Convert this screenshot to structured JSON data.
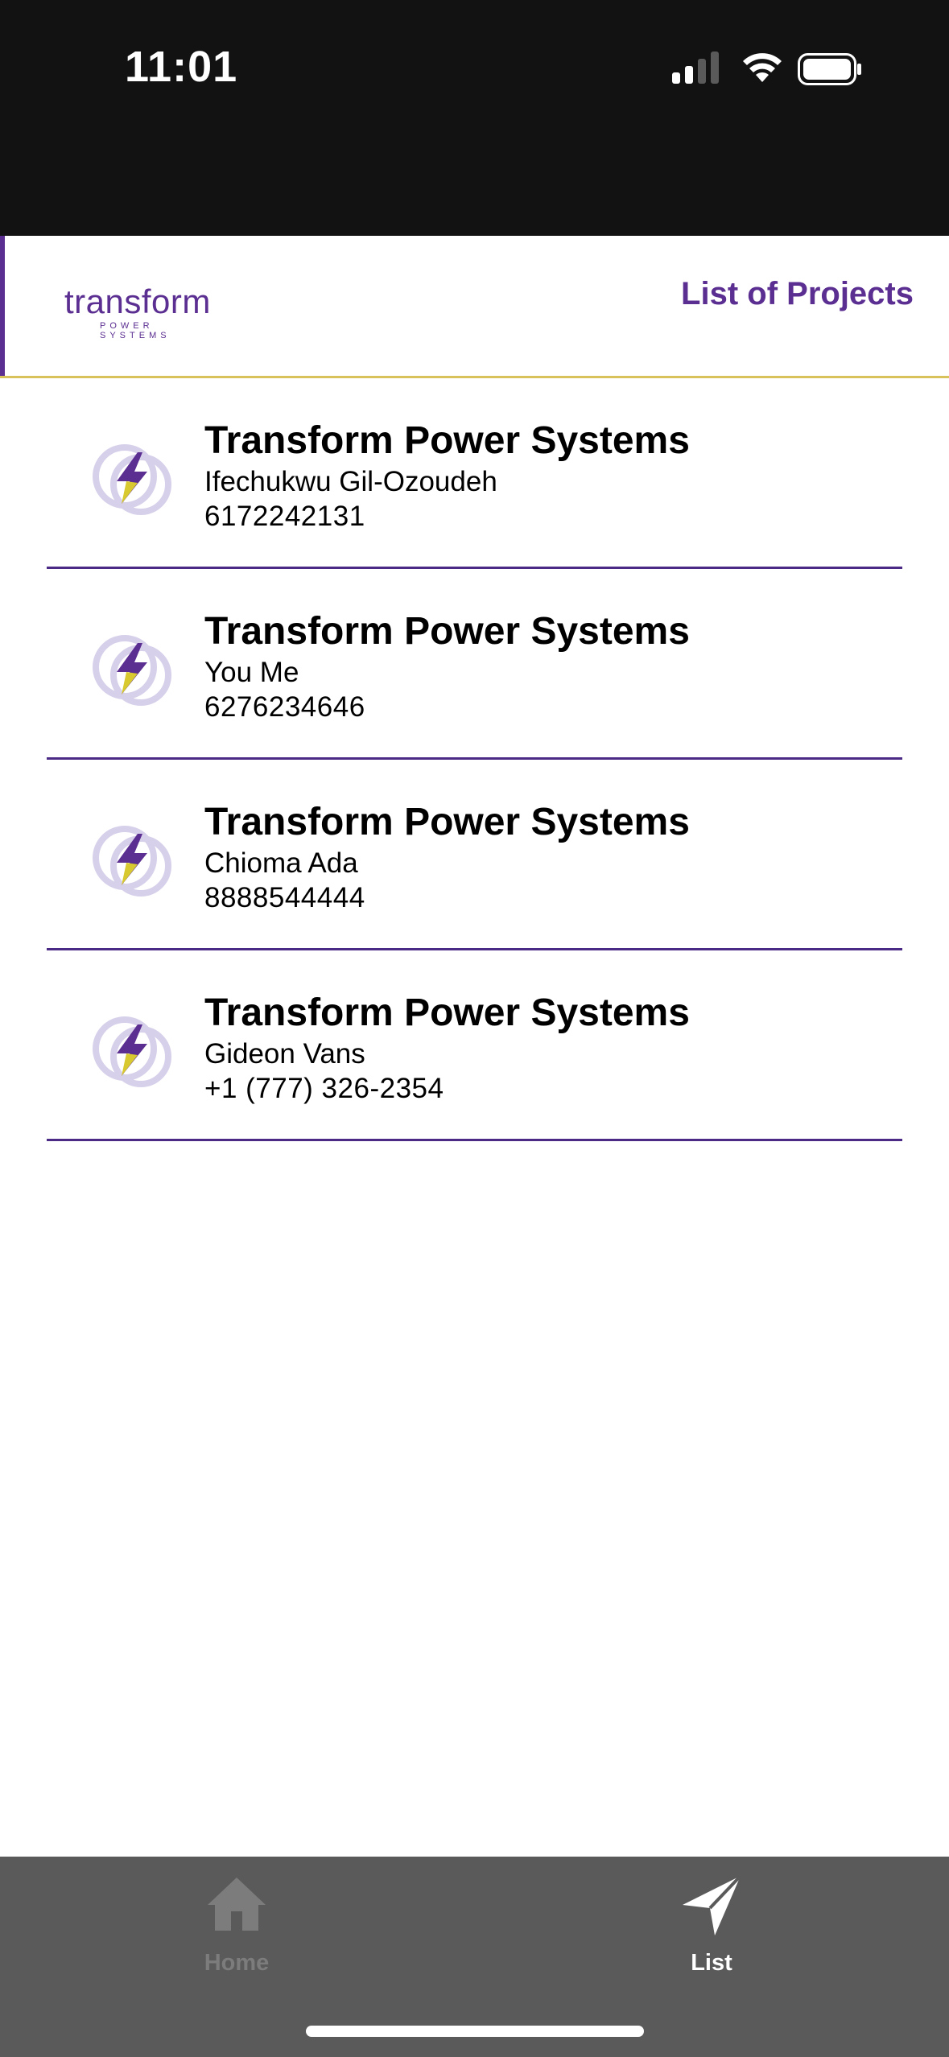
{
  "status_bar": {
    "time": "11:01",
    "icons": [
      "cellular-signal-icon",
      "wifi-icon",
      "battery-icon"
    ]
  },
  "header": {
    "logo_text": "transform",
    "logo_subtext": "POWER SYSTEMS",
    "title": "List of Projects"
  },
  "projects": [
    {
      "company": "Transform Power Systems",
      "contact": "Ifechukwu Gil-Ozoudeh",
      "phone": "6172242131"
    },
    {
      "company": "Transform Power Systems",
      "contact": "You Me",
      "phone": "6276234646"
    },
    {
      "company": "Transform Power Systems",
      "contact": "Chioma Ada",
      "phone": "8888544444"
    },
    {
      "company": "Transform Power Systems",
      "contact": "Gideon Vans",
      "phone": "+1 (777) 326-2354"
    }
  ],
  "tabs": [
    {
      "label": "Home",
      "icon": "home-icon",
      "active": false
    },
    {
      "label": "List",
      "icon": "send-icon",
      "active": true
    }
  ],
  "colors": {
    "brand_purple": "#5b2e91",
    "accent_yellow": "#d8c35a",
    "tabbar_bg": "#5a5a5a",
    "status_bg": "#121212"
  }
}
